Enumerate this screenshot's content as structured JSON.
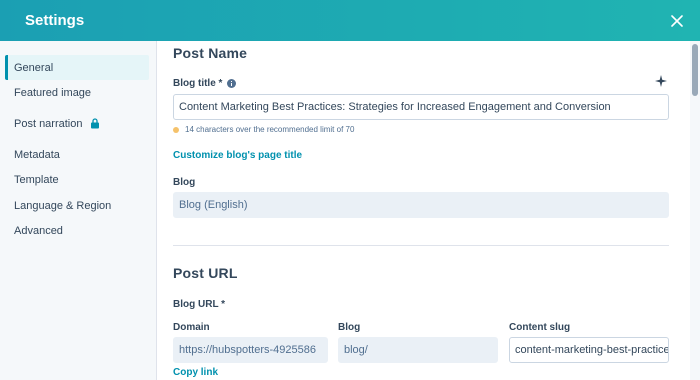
{
  "header": {
    "title": "Settings"
  },
  "sidebar": {
    "items": [
      {
        "label": "General",
        "active": true
      },
      {
        "label": "Featured image"
      },
      {
        "label": "Post narration",
        "locked": true
      },
      {
        "label": "Metadata"
      },
      {
        "label": "Template"
      },
      {
        "label": "Language & Region"
      },
      {
        "label": "Advanced"
      }
    ]
  },
  "post_name": {
    "section_title": "Post Name",
    "blog_title_label": "Blog title *",
    "blog_title_value": "Content Marketing Best Practices: Strategies for Increased Engagement and Conversion",
    "hint": "14 characters over the recommended limit of 70",
    "customize_link": "Customize blog's page title",
    "blog_label": "Blog",
    "blog_value": "Blog (English)"
  },
  "post_url": {
    "section_title": "Post URL",
    "blog_url_label": "Blog URL *",
    "domain_label": "Domain",
    "domain_value": "https://hubspotters-4925586",
    "blog_label": "Blog",
    "blog_value": "blog/",
    "slug_label": "Content slug",
    "slug_value": "content-marketing-best-practices",
    "copy_link": "Copy link"
  },
  "colors": {
    "header": "#1b9fb3",
    "accent": "#0091ae",
    "warning_dot": "#f5c26b"
  },
  "icons": {
    "close": "close-icon",
    "info": "info-icon",
    "sparkle": "sparkle-icon",
    "lock": "lock-icon"
  }
}
